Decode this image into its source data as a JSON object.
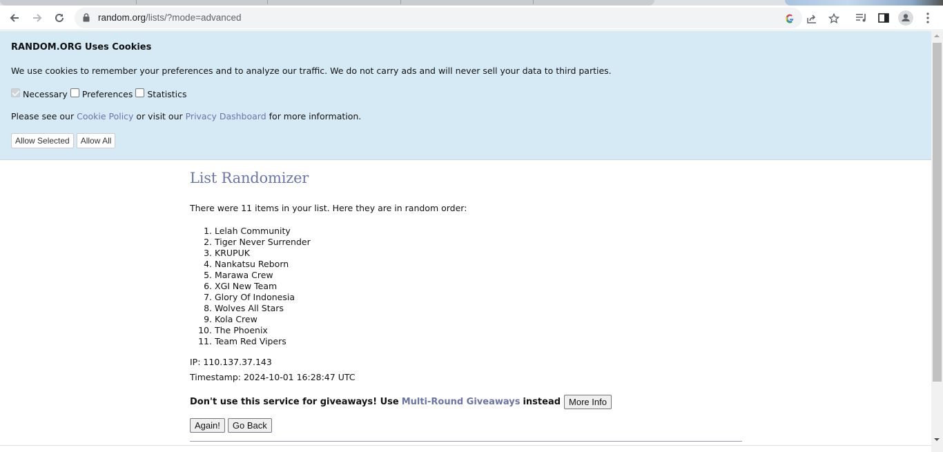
{
  "browser": {
    "url_host": "random.org",
    "url_path": "/lists/?mode=advanced",
    "icons": {
      "back": "arrow-left-icon",
      "forward": "arrow-right-icon",
      "reload": "reload-icon",
      "lock": "lock-icon",
      "google": "google-icon",
      "share": "share-icon",
      "bookmark": "star-icon",
      "media": "media-control-icon",
      "side_panel": "side-panel-icon",
      "profile": "profile-icon",
      "menu": "kebab-menu-icon"
    }
  },
  "cookie_banner": {
    "title": "RANDOM.ORG Uses Cookies",
    "text": "We use cookies to remember your preferences and to analyze our traffic. We do not carry ads and will never sell your data to third parties.",
    "checkboxes": [
      {
        "label": "Necessary",
        "checked": true,
        "disabled": true
      },
      {
        "label": "Preferences",
        "checked": false,
        "disabled": false
      },
      {
        "label": "Statistics",
        "checked": false,
        "disabled": false
      }
    ],
    "info_prefix": "Please see our ",
    "cookie_policy_link": "Cookie Policy",
    "info_middle": " or visit our ",
    "privacy_dashboard_link": "Privacy Dashboard",
    "info_suffix": " for more information.",
    "allow_selected_label": "Allow Selected",
    "allow_all_label": "Allow All"
  },
  "main": {
    "title": "List Randomizer",
    "intro": "There were 11 items in your list. Here they are in random order:",
    "items": [
      {
        "num": "1.",
        "label": "Lelah Community"
      },
      {
        "num": "2.",
        "label": "Tiger Never Surrender"
      },
      {
        "num": "3.",
        "label": "KRUPUK"
      },
      {
        "num": "4.",
        "label": "Nankatsu Reborn"
      },
      {
        "num": "5.",
        "label": "Marawa Crew"
      },
      {
        "num": "6.",
        "label": "XGI New Team"
      },
      {
        "num": "7.",
        "label": "Glory Of Indonesia"
      },
      {
        "num": "8.",
        "label": "Wolves All Stars"
      },
      {
        "num": "9.",
        "label": "Kola Crew"
      },
      {
        "num": "10.",
        "label": "The Phoenix"
      },
      {
        "num": "11.",
        "label": "Team Red Vipers"
      }
    ],
    "ip": "IP: 110.137.37.143",
    "timestamp": "Timestamp: 2024-10-01 16:28:47 UTC",
    "giveaway_prefix": "Don't use this service for giveaways! Use",
    "giveaway_link": "Multi-Round Giveaways",
    "giveaway_suffix": "instead",
    "more_info_label": "More Info",
    "again_label": "Again!",
    "go_back_label": "Go Back"
  }
}
